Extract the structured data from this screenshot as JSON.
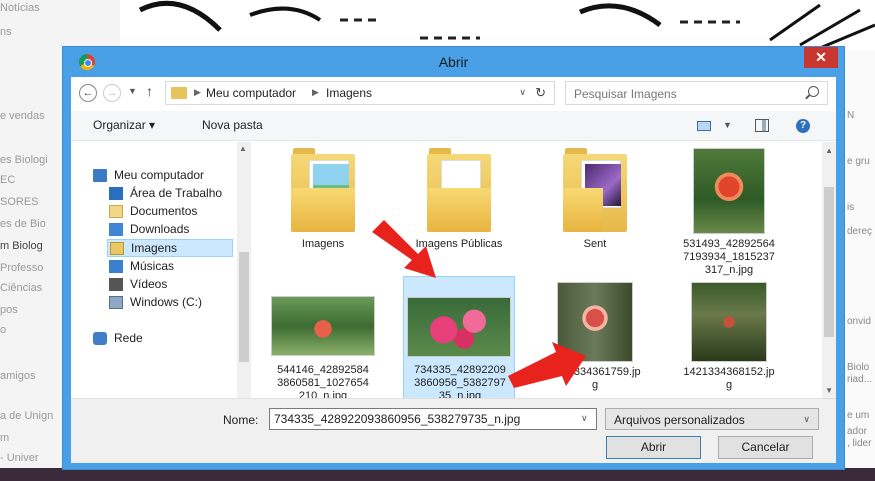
{
  "background": {
    "left_lines": [
      {
        "text": "Notícias",
        "dark": false
      },
      {
        "text": "ns",
        "dark": false
      },
      {
        "text": "e vendas",
        "dark": false
      },
      {
        "text": "es Biologi",
        "dark": false
      },
      {
        "text": "EC",
        "dark": false
      },
      {
        "text": "SORES",
        "dark": false
      },
      {
        "text": "es de Bio",
        "dark": false
      },
      {
        "text": "m Biolog",
        "dark": true
      },
      {
        "text": "Professo",
        "dark": false
      },
      {
        "text": "Ciências",
        "dark": false
      },
      {
        "text": "pos",
        "dark": false
      },
      {
        "text": "o",
        "dark": false
      },
      {
        "text": "amigos",
        "dark": false
      },
      {
        "text": "a de Unign",
        "dark": false
      },
      {
        "text": "m",
        "dark": false
      },
      {
        "text": "- Univer",
        "dark": false
      }
    ],
    "right_lines": [
      "N",
      "e gru",
      "is",
      "dereç",
      "onvid",
      "Biolo",
      "riad...",
      "e um",
      "ador",
      ", lider"
    ]
  },
  "dialog": {
    "title": "Abrir",
    "close_label": "✕",
    "address": {
      "crumbs": [
        "Meu computador",
        "Imagens"
      ]
    },
    "search_placeholder": "Pesquisar Imagens",
    "toolbar": {
      "organize_label": "Organizar ▾",
      "new_folder_label": "Nova pasta"
    },
    "sidebar": {
      "items": [
        {
          "label": "Meu computador",
          "icon": "computer-icon"
        },
        {
          "label": "Área de Trabalho",
          "icon": "desktop-icon"
        },
        {
          "label": "Documentos",
          "icon": "documents-icon"
        },
        {
          "label": "Downloads",
          "icon": "downloads-icon"
        },
        {
          "label": "Imagens",
          "icon": "images-folder-icon",
          "selected": true
        },
        {
          "label": "Músicas",
          "icon": "music-icon"
        },
        {
          "label": "Vídeos",
          "icon": "videos-icon"
        },
        {
          "label": "Windows (C:)",
          "icon": "drive-icon"
        },
        {
          "label": "Rede",
          "icon": "network-icon"
        }
      ]
    },
    "files": [
      {
        "name": "Imagens",
        "kind": "folder",
        "icon": "folder-landscape-icon"
      },
      {
        "name": "Imagens Públicas",
        "kind": "folder",
        "icon": "folder-icon"
      },
      {
        "name": "Sent",
        "kind": "folder",
        "icon": "folder-purple-icon"
      },
      {
        "name": "531493_428925647193934_1815237317_n.jpg",
        "kind": "photo",
        "name_lines": [
          "531493_42892564",
          "7193934_1815237",
          "317_n.jpg"
        ]
      },
      {
        "name": "544146_428925843860581_1027654210_n.jpg",
        "kind": "photo",
        "name_lines": [
          "544146_42892584",
          "3860581_1027654",
          "210_n.jpg"
        ]
      },
      {
        "name": "734335_428922093860956_538279735_n.jpg",
        "kind": "photo",
        "selected": true,
        "name_lines": [
          "734335_42892209",
          "3860956_5382797",
          "35_n.jpg"
        ]
      },
      {
        "name": "1421334361759.jpg",
        "kind": "photo",
        "name_lines": [
          "1421334361759.jp",
          "g"
        ]
      },
      {
        "name": "1421334368152.jpg",
        "kind": "photo",
        "name_lines": [
          "1421334368152.jp",
          "g"
        ]
      }
    ],
    "bottom": {
      "name_label": "Nome:",
      "name_value": "734335_428922093860956_538279735_n.jpg",
      "file_type": "Arquivos personalizados",
      "open_label": "Abrir",
      "cancel_label": "Cancelar"
    }
  },
  "colors": {
    "dialog_frame": "#4aa0e6",
    "close_button": "#c7372f",
    "selection": "#cce8ff",
    "annotation_arrow": "#e8231d"
  }
}
